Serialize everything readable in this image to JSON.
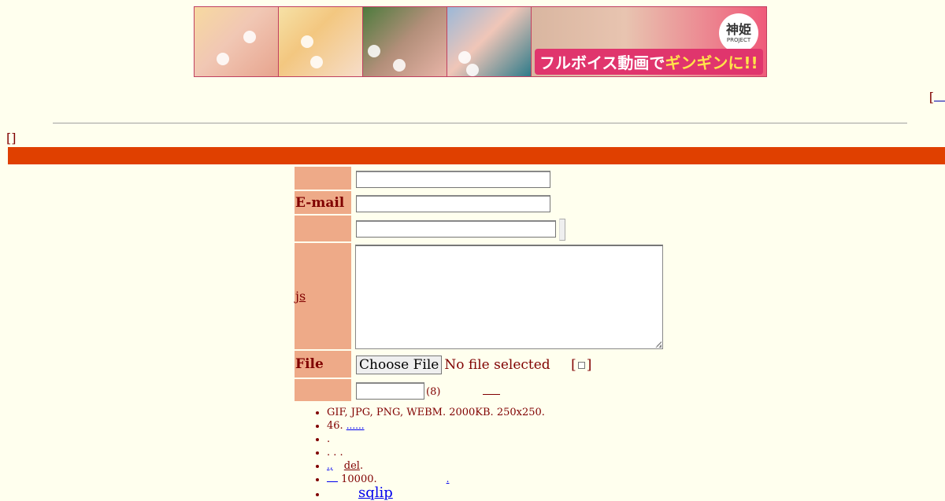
{
  "banner": {
    "caption_part1": "フルボイス動画で",
    "caption_part2": "ギンギンに!!",
    "logo_title": "神姫",
    "logo_sub": "PROJECT"
  },
  "topnav": {
    "open_bracket": "["
  },
  "mode_label": "[]",
  "form": {
    "email_label": "E-mail",
    "js_link": "js",
    "file_label": "File",
    "file_button": "Choose File",
    "file_status": "No file selected",
    "temp_open": "[",
    "temp_close": "]",
    "password_hint": "(8)"
  },
  "rules": {
    "item1": "GIF, JPG, PNG, WEBM. 2000KB. 250x250.",
    "item2_text": "46.",
    "item2_link": "......",
    "item3": ".",
    "item4": ". . .",
    "item5_link": ".,",
    "item5_del": "del",
    "item5_tail": ".",
    "item6_text": "10000.",
    "item6_link": ".",
    "item7_link": "sqlip"
  },
  "colors": {
    "background": "#ffffee",
    "text": "#800000",
    "post_bar": "#e04000",
    "label_bg": "#eeaa88"
  }
}
